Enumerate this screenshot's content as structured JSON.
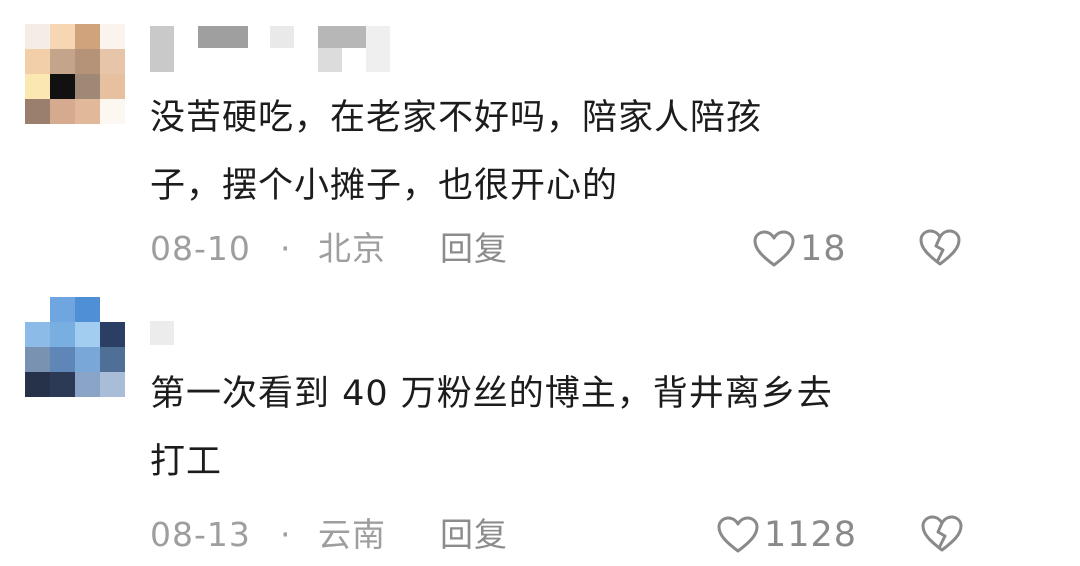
{
  "comments": [
    {
      "text": "没苦硬吃，在老家不好吗，陪家人陪孩\n子，摆个小摊子，也很开心的",
      "date": "08-10",
      "separator": "·",
      "location": "北京",
      "reply_label": "回复",
      "like_count": "18",
      "avatar_colors": [
        "#f4ede6",
        "#f7d6b4",
        "#d1a37d",
        "#fbf4ee",
        "#f2cfa8",
        "#c4a48a",
        "#b59378",
        "#e6c5a8",
        "#fbe7b1",
        "#111111",
        "#a08877",
        "#e7c0a0",
        "#9a7e6e",
        "#d6aa8e",
        "#e1b99a",
        "#fdf7f2"
      ],
      "username_colors": [
        "#c9c9c9",
        "#9f9f9f",
        "#e9e9e9",
        "#b7b7b7",
        "#dcdcdc",
        "#efefef"
      ]
    },
    {
      "text": "第一次看到 40 万粉丝的博主，背井离乡去\n打工",
      "date": "08-13",
      "separator": "·",
      "location": "云南",
      "reply_label": "回复",
      "like_count": "1128",
      "avatar_colors": [
        "#ffffff",
        "#6fa6df",
        "#4f8fd6",
        "#ffffff",
        "#8cbbe8",
        "#79aee0",
        "#a3cdf0",
        "#2a3f63",
        "#7a92b2",
        "#5e86b6",
        "#79a7d8",
        "#4f6f97",
        "#25324a",
        "#2d3a55",
        "#8aa4c7",
        "#a9bdd8"
      ],
      "username_colors": [
        "#ececec"
      ]
    }
  ]
}
